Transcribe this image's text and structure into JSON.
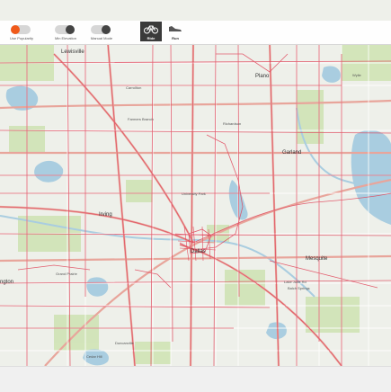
{
  "toolbar": {
    "toggles": [
      {
        "label": "Use Popularity",
        "state": "on"
      },
      {
        "label": "Min Elevation",
        "state": "off"
      },
      {
        "label": "Manual Mode",
        "state": "off"
      }
    ],
    "modes": [
      {
        "label": "Ride",
        "icon": "bike-icon",
        "active": true
      },
      {
        "label": "Run",
        "icon": "shoe-icon",
        "active": false
      }
    ]
  },
  "map": {
    "cities": {
      "lewisville": "Lewisville",
      "plano": "Plano",
      "wylie": "Wylie",
      "carrollton": "Carrollton",
      "farmers_branch": "Farmers Branch",
      "richardson": "Richardson",
      "garland": "Garland",
      "university_park": "University Park",
      "irving": "Irving",
      "dallas": "Dallas",
      "mesquite": "Mesquite",
      "grand_prairie": "Grand Prairie",
      "arlington": "ngton",
      "duncanville": "Duncanville",
      "balch_springs": "Balch Springs",
      "lake_june": "Lake June Rd",
      "cedar_hill": "Cedar Hill"
    },
    "colors": {
      "water": "#a9cde0",
      "park": "#cfe3b5",
      "route": "#e0455a",
      "highway": "#e8a59b"
    }
  }
}
